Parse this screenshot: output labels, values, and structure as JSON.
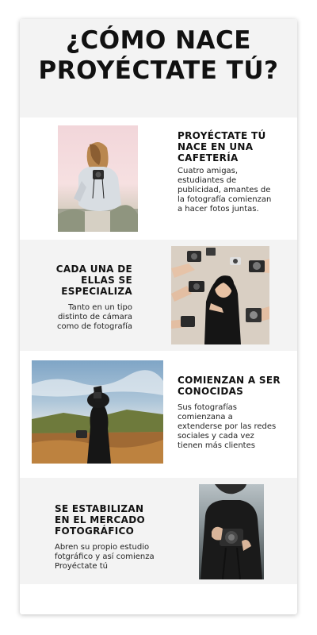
{
  "title": "¿CÓMO NACE PROYÉCTATE TÚ?",
  "sections": [
    {
      "heading": "PROYÉCTATE TÚ NACE EN UNA CAFETERÍA",
      "text": "Cuatro amigas, estudiantes de publicidad, amantes de la fotografía comienzan a hacer fotos juntas.",
      "photo_icon": "woman-with-camera-photo"
    },
    {
      "heading": "CADA UNA DE ELLAS SE ESPECIALIZA",
      "text": "Tanto en un tipo distinto de cámara como de fotografía",
      "photo_icon": "hands-holding-cameras-photo"
    },
    {
      "heading": "COMIENZAN A SER CONOCIDAS",
      "text": "Sus fotografías comienzana a extenderse por las redes sociales y cada vez tienen más clientes",
      "photo_icon": "woman-photographing-sky-photo"
    },
    {
      "heading": "SE ESTABILIZAN EN EL MERCADO FOTOGRÁFICO",
      "text": "Abren su propio estudio fotgráfico y así comienza Proyéctate tú",
      "photo_icon": "woman-holding-camera-photo"
    }
  ],
  "colors": {
    "header_bg": "#f3f3f3",
    "alt_bg": "#f3f3f3",
    "text": "#111111"
  }
}
